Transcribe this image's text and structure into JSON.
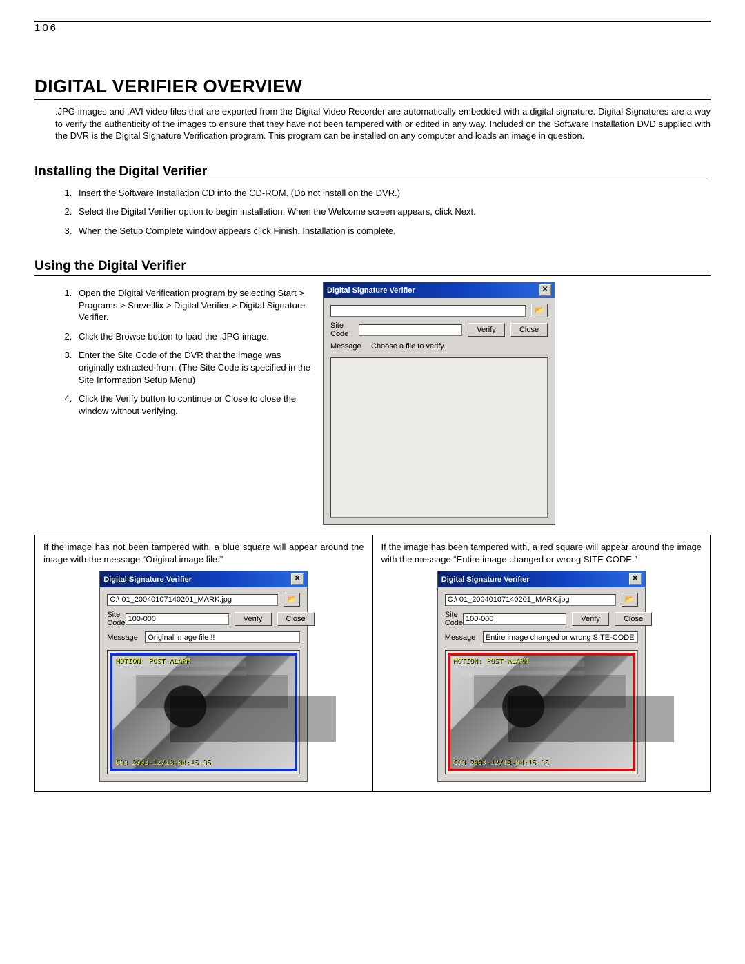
{
  "page_number": "106",
  "heading": "DIGITAL VERIFIER OVERVIEW",
  "intro": ".JPG images and .AVI video files that are exported from the Digital Video Recorder are automatically embedded with a digital signature. Digital Signatures are a way to verify the authenticity of the images to ensure that they have not been tampered with or edited in any way. Included on the Software Installation DVD supplied with the DVR is the Digital Signature Verification program. This program can be installed on any computer and loads an image in question.",
  "install_heading": "Installing the Digital Verifier",
  "install_steps": {
    "s1": "Insert the Software Installation CD into the CD-ROM.  (Do not install on the DVR.)",
    "s2": "Select the Digital Verifier option to begin installation.  When the Welcome screen appears, click Next.",
    "s3": "When the Setup Complete window appears click Finish.  Installation is complete."
  },
  "using_heading": "Using the Digital Verifier",
  "using_steps": {
    "s1": "Open the Digital Verification program by selecting Start > Programs > Surveillix > Digital Verifier > Digital Signature Verifier.",
    "s2": "Click the Browse button to load the .JPG image.",
    "s3": "Enter the Site Code of the DVR that the image was originally extracted from.  (The Site Code is specified in the Site Information Setup Menu)",
    "s4": "Click the Verify button to continue or Close to close the window without verifying."
  },
  "app": {
    "title": "Digital Signature Verifier",
    "sitecode_label": "Site Code",
    "message_label": "Message",
    "verify_btn": "Verify",
    "close_btn": "Close",
    "browse_icon": "folder-open-icon",
    "empty": {
      "path": "",
      "sitecode": "",
      "message": "Choose a file to verify."
    },
    "good": {
      "path": "C:\\ 01_20040107140201_MARK.jpg",
      "sitecode": "100-000",
      "message": "Original image file !!",
      "overlay_top": "MOTION: POST-ALARM",
      "overlay_bottom": "C03 2003-12/18-04:15:35"
    },
    "bad": {
      "path": "C:\\ 01_20040107140201_MARK.jpg",
      "sitecode": "100-000",
      "message": "Entire image changed or wrong SITE-CODE !!",
      "overlay_top": "MOTION: POST-ALARM",
      "overlay_bottom": "C03 2003-12/18-04:15:35"
    }
  },
  "results": {
    "good_desc": "If the image has not been tampered with, a blue square will appear around the image with the message “Original image file.”",
    "bad_desc": "If the image has been tampered with, a red square will appear around the image with the message “Entire image changed or wrong SITE CODE.”"
  }
}
